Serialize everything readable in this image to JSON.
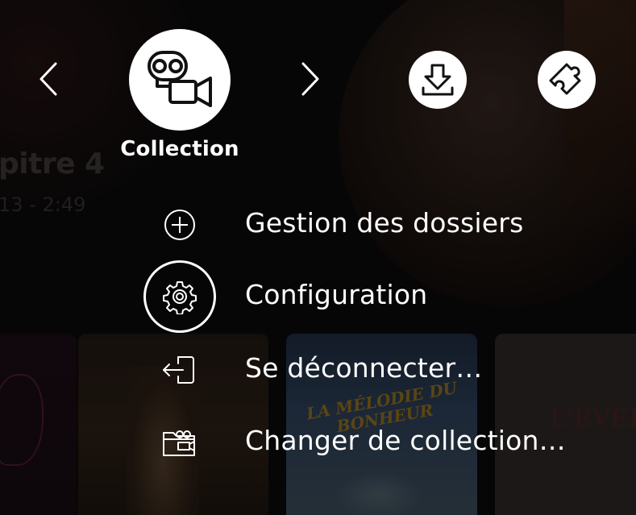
{
  "background": {
    "feature_title": "pitre 4",
    "feature_time": "13 - 2:49",
    "posters": [
      {
        "text": ""
      },
      {
        "text": ""
      },
      {
        "text": "LA MÉLODIE DU BONHEUR"
      },
      {
        "text": "L'EVEIL"
      }
    ]
  },
  "carousel": {
    "prev_icon": "chevron-left-icon",
    "next_icon": "chevron-right-icon",
    "current_module": {
      "label": "Collection",
      "icon": "film-camera-icon"
    },
    "other_modules": [
      {
        "icon": "download-icon"
      },
      {
        "icon": "puzzle-plugin-icon"
      }
    ]
  },
  "menu": {
    "items": [
      {
        "label": "Gestion des dossiers",
        "icon": "add-circle-icon"
      },
      {
        "label": "Configuration",
        "icon": "gear-icon",
        "selected": true
      },
      {
        "label": "Se déconnecter…",
        "icon": "logout-icon"
      },
      {
        "label": "Changer de collection…",
        "icon": "folder-film-icon"
      }
    ]
  },
  "colors": {
    "background": "#0b0a0a",
    "foreground": "#ffffff"
  }
}
